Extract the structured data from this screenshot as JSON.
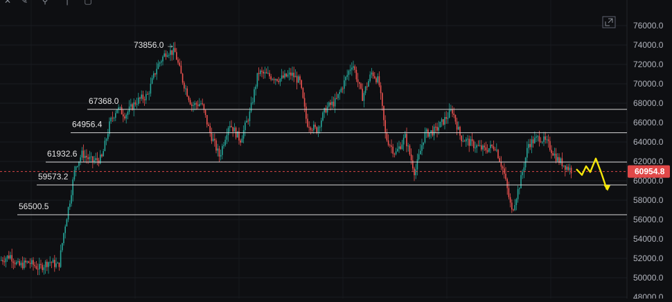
{
  "chart_data": {
    "type": "candlestick",
    "y_range": [
      48000,
      77000
    ],
    "y_ticks": [
      "76000.0",
      "74000.0",
      "72000.0",
      "70000.0",
      "68000.0",
      "66000.0",
      "64000.0",
      "62000.0",
      "60000.0",
      "58000.0",
      "56000.0",
      "54000.0",
      "52000.0",
      "50000.0",
      "48000.0"
    ],
    "y_tick_values": [
      76000,
      74000,
      72000,
      70000,
      68000,
      66000,
      64000,
      62000,
      60000,
      58000,
      56000,
      54000,
      52000,
      50000,
      48000
    ],
    "current_price": 60954.8,
    "current_price_label": "60954.8",
    "peak": {
      "value": 73856.0,
      "label": "73856.0 →"
    },
    "levels": [
      {
        "value": 67368.0,
        "label": "67368.0"
      },
      {
        "value": 64956.4,
        "label": "64956.4"
      },
      {
        "value": 61932.6,
        "label": "61932.6"
      },
      {
        "value": 59573.2,
        "label": "59573.2"
      },
      {
        "value": 56500.5,
        "label": "56500.5"
      }
    ],
    "price_path": [
      [
        0,
        51800
      ],
      [
        14,
        52300
      ],
      [
        26,
        51200
      ],
      [
        40,
        51600
      ],
      [
        56,
        51000
      ],
      [
        70,
        51700
      ],
      [
        84,
        51200
      ],
      [
        92,
        55000
      ],
      [
        100,
        58000
      ],
      [
        108,
        61500
      ],
      [
        118,
        62800
      ],
      [
        132,
        62000
      ],
      [
        146,
        62300
      ],
      [
        158,
        66000
      ],
      [
        168,
        67500
      ],
      [
        180,
        66800
      ],
      [
        196,
        68200
      ],
      [
        212,
        68800
      ],
      [
        226,
        71800
      ],
      [
        240,
        73400
      ],
      [
        252,
        73200
      ],
      [
        262,
        70500
      ],
      [
        276,
        67800
      ],
      [
        290,
        68000
      ],
      [
        302,
        65000
      ],
      [
        316,
        62500
      ],
      [
        330,
        66000
      ],
      [
        346,
        64200
      ],
      [
        360,
        67000
      ],
      [
        372,
        71200
      ],
      [
        388,
        70800
      ],
      [
        404,
        70500
      ],
      [
        420,
        71000
      ],
      [
        432,
        70200
      ],
      [
        442,
        66000
      ],
      [
        456,
        65200
      ],
      [
        470,
        67500
      ],
      [
        484,
        68200
      ],
      [
        498,
        70500
      ],
      [
        508,
        72200
      ],
      [
        522,
        68600
      ],
      [
        536,
        71200
      ],
      [
        546,
        70200
      ],
      [
        556,
        64500
      ],
      [
        570,
        62800
      ],
      [
        584,
        64500
      ],
      [
        598,
        60800
      ],
      [
        612,
        64800
      ],
      [
        628,
        65200
      ],
      [
        642,
        66400
      ],
      [
        652,
        67300
      ],
      [
        664,
        64500
      ],
      [
        680,
        63800
      ],
      [
        698,
        63200
      ],
      [
        714,
        63600
      ],
      [
        726,
        61000
      ],
      [
        738,
        56800
      ],
      [
        750,
        59800
      ],
      [
        762,
        63800
      ],
      [
        778,
        64500
      ],
      [
        790,
        63800
      ],
      [
        804,
        62200
      ],
      [
        816,
        61500
      ],
      [
        826,
        61000
      ]
    ],
    "forecast": [
      [
        832,
        61200
      ],
      [
        840,
        60600
      ],
      [
        846,
        61500
      ],
      [
        852,
        60900
      ],
      [
        860,
        62300
      ],
      [
        868,
        60800
      ],
      [
        876,
        59100
      ]
    ]
  }
}
